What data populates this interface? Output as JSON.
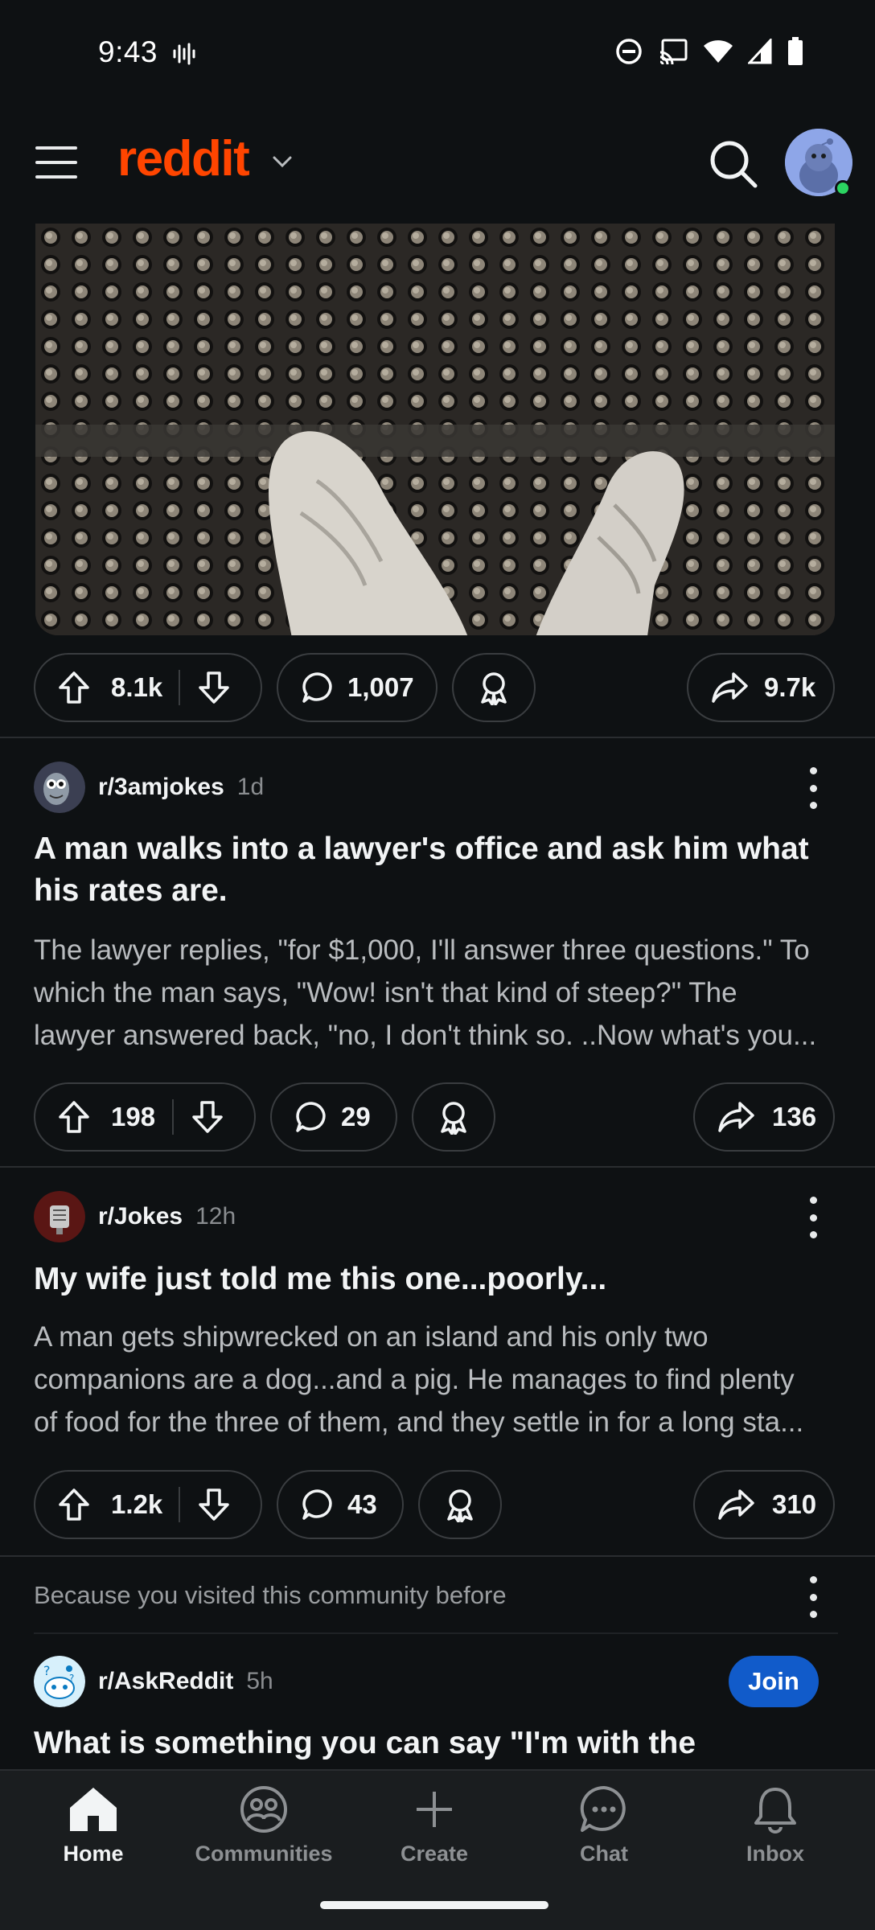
{
  "status_bar": {
    "time": "9:43"
  },
  "header": {
    "logo": "reddit"
  },
  "feed": {
    "image_post": {
      "upvotes": "8.1k",
      "comments": "1,007",
      "shares": "9.7k"
    },
    "posts": [
      {
        "subreddit": "r/3amjokes",
        "age": "1d",
        "title_lines": [
          "A man walks into a lawyer's office and ask him what",
          "his rates are."
        ],
        "body_lines": [
          "The lawyer replies, \"for $1,000, I'll answer three questions.\" To",
          "which the man says, \"Wow! isn't that kind of steep?\" The",
          "lawyer answered back, \"no, I don't think so. ..Now what's you..."
        ],
        "upvotes": "198",
        "comments": "29",
        "shares": "136"
      },
      {
        "subreddit": "r/Jokes",
        "age": "12h",
        "title_lines": [
          "My wife just told me this one...poorly..."
        ],
        "body_lines": [
          "A man gets shipwrecked on an island and his only two",
          "companions are a dog...and a pig. He manages to find plenty",
          "of food for the three of them, and they settle in for a long sta..."
        ],
        "upvotes": "1.2k",
        "comments": "43",
        "shares": "310"
      }
    ],
    "recommended": {
      "reason": "Because you visited this community before",
      "subreddit": "r/AskReddit",
      "age": "5h",
      "join_label": "Join",
      "title": "What is something you can say \"I'm with the"
    }
  },
  "bottom_nav": {
    "items": [
      {
        "label": "Home",
        "icon": "home-icon",
        "active": true
      },
      {
        "label": "Communities",
        "icon": "communities-icon",
        "active": false
      },
      {
        "label": "Create",
        "icon": "plus-icon",
        "active": false
      },
      {
        "label": "Chat",
        "icon": "chat-icon",
        "active": false
      },
      {
        "label": "Inbox",
        "icon": "bell-icon",
        "active": false
      }
    ]
  },
  "colors": {
    "background": "#0e1113",
    "brand": "#ff4500",
    "join": "#115bca",
    "online": "#2bd461"
  }
}
